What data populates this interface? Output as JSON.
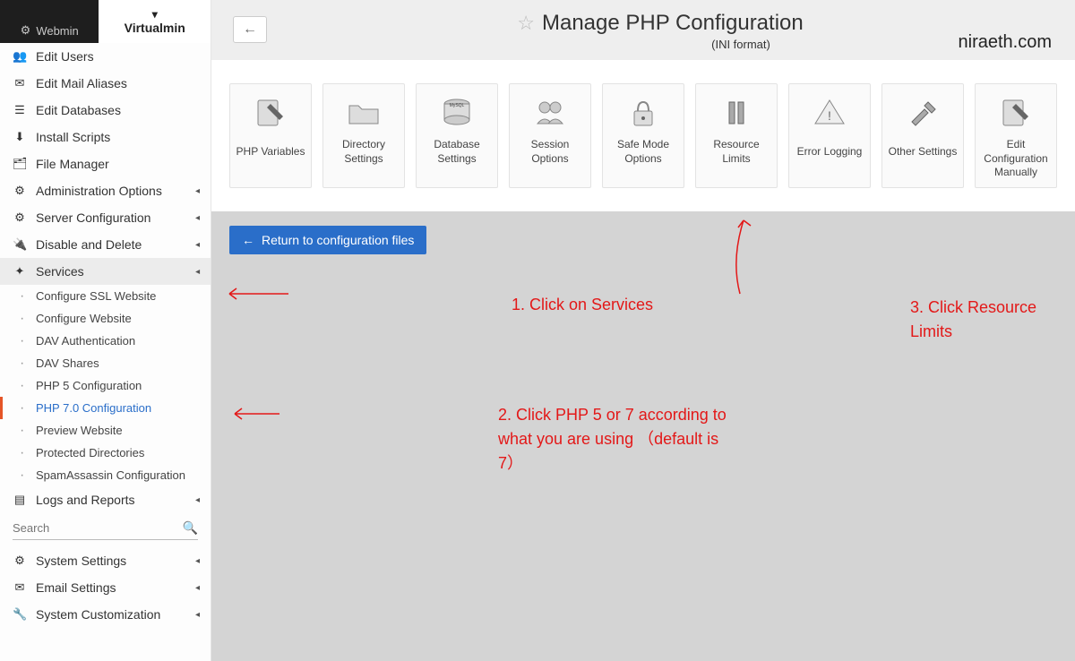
{
  "tabs": {
    "webmin": "Webmin",
    "virtualmin": "Virtualmin"
  },
  "sidebar": {
    "items": [
      {
        "icon": "users",
        "label": "Edit Users"
      },
      {
        "icon": "mail",
        "label": "Edit Mail Aliases"
      },
      {
        "icon": "db",
        "label": "Edit Databases"
      },
      {
        "icon": "install",
        "label": "Install Scripts"
      },
      {
        "icon": "folder",
        "label": "File Manager"
      },
      {
        "icon": "gear",
        "label": "Administration Options",
        "caret": true
      },
      {
        "icon": "sliders",
        "label": "Server Configuration",
        "caret": true
      },
      {
        "icon": "plug",
        "label": "Disable and Delete",
        "caret": true
      },
      {
        "icon": "puzzle",
        "label": "Services",
        "caret": true,
        "expanded": true
      }
    ],
    "services_sub": [
      {
        "label": "Configure SSL Website"
      },
      {
        "label": "Configure Website"
      },
      {
        "label": "DAV Authentication"
      },
      {
        "label": "DAV Shares"
      },
      {
        "label": "PHP 5 Configuration"
      },
      {
        "label": "PHP 7.0 Configuration",
        "active": true
      },
      {
        "label": "Preview Website"
      },
      {
        "label": "Protected Directories"
      },
      {
        "label": "SpamAssassin Configuration"
      }
    ],
    "after_services": [
      {
        "icon": "doc",
        "label": "Logs and Reports",
        "caret": true
      }
    ],
    "search_placeholder": "Search",
    "bottom": [
      {
        "icon": "gear",
        "label": "System Settings",
        "caret": true
      },
      {
        "icon": "mail",
        "label": "Email Settings",
        "caret": true
      },
      {
        "icon": "wrench",
        "label": "System Customization",
        "caret": true
      }
    ]
  },
  "header": {
    "title": "Manage PHP Configuration",
    "subtitle": "(INI format)",
    "watermark": "niraeth.com"
  },
  "tiles": [
    {
      "name": "php-variables",
      "label": "PHP Variables",
      "icon": "edit-doc"
    },
    {
      "name": "directory-settings",
      "label": "Directory Settings",
      "icon": "folder-open"
    },
    {
      "name": "database-settings",
      "label": "Database Settings",
      "icon": "db-stack"
    },
    {
      "name": "session-options",
      "label": "Session Options",
      "icon": "people"
    },
    {
      "name": "safe-mode-options",
      "label": "Safe Mode Options",
      "icon": "lock"
    },
    {
      "name": "resource-limits",
      "label": "Resource Limits",
      "icon": "bars"
    },
    {
      "name": "error-logging",
      "label": "Error Logging",
      "icon": "warn"
    },
    {
      "name": "other-settings",
      "label": "Other Settings",
      "icon": "tools"
    },
    {
      "name": "edit-config-manually",
      "label": "Edit Configuration Manually",
      "icon": "edit-doc2"
    }
  ],
  "return_btn": "Return to configuration files",
  "annotations": {
    "a1": "1. Click on Services",
    "a2": "2. Click PHP 5 or 7 according to what you are using （default is 7）",
    "a3": "3. Click Resource Limits"
  }
}
